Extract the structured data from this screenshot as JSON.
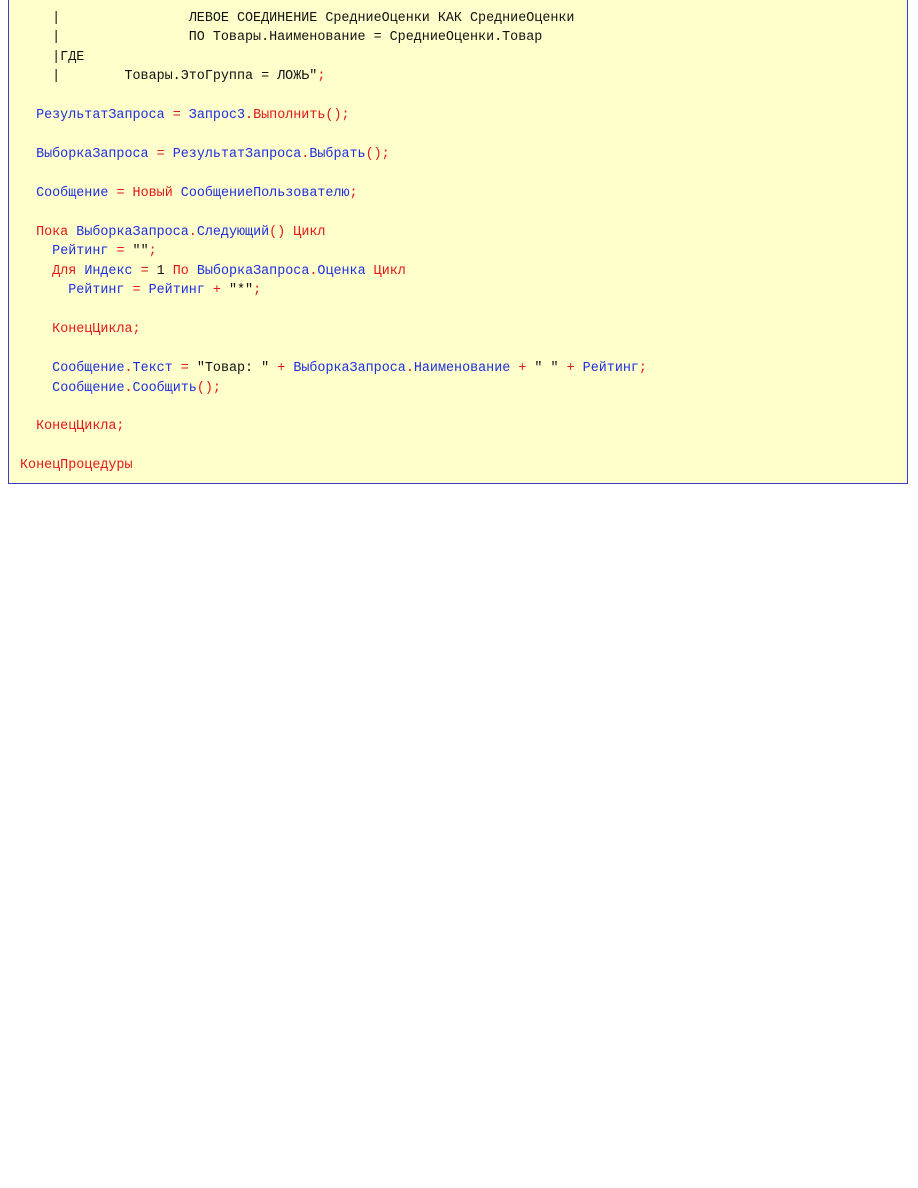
{
  "code": {
    "lines": [
      [
        {
          "c": "t",
          "s": "    |                ЛЕВОЕ СОЕДИНЕНИЕ СредниеОценки КАК СредниеОценки"
        }
      ],
      [
        {
          "c": "t",
          "s": "    |                ПО Товары.Наименование = СредниеОценки.Товар"
        }
      ],
      [
        {
          "c": "t",
          "s": "    |ГДЕ"
        }
      ],
      [
        {
          "c": "t",
          "s": "    |        Товары.ЭтоГруппа = ЛОЖЬ\""
        },
        {
          "c": "k",
          "s": ";"
        }
      ],
      [],
      [
        {
          "c": "t",
          "s": "  "
        },
        {
          "c": "i",
          "s": "РезультатЗапроса"
        },
        {
          "c": "t",
          "s": " "
        },
        {
          "c": "k",
          "s": "="
        },
        {
          "c": "t",
          "s": " "
        },
        {
          "c": "i",
          "s": "Запрос3"
        },
        {
          "c": "k",
          "s": "."
        },
        {
          "c": "k",
          "s": "Выполнить"
        },
        {
          "c": "k",
          "s": "();"
        }
      ],
      [],
      [
        {
          "c": "t",
          "s": "  "
        },
        {
          "c": "i",
          "s": "ВыборкаЗапроса"
        },
        {
          "c": "t",
          "s": " "
        },
        {
          "c": "k",
          "s": "="
        },
        {
          "c": "t",
          "s": " "
        },
        {
          "c": "i",
          "s": "РезультатЗапроса"
        },
        {
          "c": "k",
          "s": "."
        },
        {
          "c": "i",
          "s": "Выбрать"
        },
        {
          "c": "k",
          "s": "();"
        }
      ],
      [],
      [
        {
          "c": "t",
          "s": "  "
        },
        {
          "c": "i",
          "s": "Сообщение"
        },
        {
          "c": "t",
          "s": " "
        },
        {
          "c": "k",
          "s": "="
        },
        {
          "c": "t",
          "s": " "
        },
        {
          "c": "k",
          "s": "Новый"
        },
        {
          "c": "t",
          "s": " "
        },
        {
          "c": "i",
          "s": "СообщениеПользователю"
        },
        {
          "c": "k",
          "s": ";"
        }
      ],
      [],
      [
        {
          "c": "t",
          "s": "  "
        },
        {
          "c": "k",
          "s": "Пока"
        },
        {
          "c": "t",
          "s": " "
        },
        {
          "c": "i",
          "s": "ВыборкаЗапроса"
        },
        {
          "c": "k",
          "s": "."
        },
        {
          "c": "i",
          "s": "Следующий"
        },
        {
          "c": "k",
          "s": "()"
        },
        {
          "c": "t",
          "s": " "
        },
        {
          "c": "k",
          "s": "Цикл"
        }
      ],
      [
        {
          "c": "t",
          "s": "    "
        },
        {
          "c": "i",
          "s": "Рейтинг"
        },
        {
          "c": "t",
          "s": " "
        },
        {
          "c": "k",
          "s": "="
        },
        {
          "c": "t",
          "s": " \"\""
        },
        {
          "c": "k",
          "s": ";"
        }
      ],
      [
        {
          "c": "t",
          "s": "    "
        },
        {
          "c": "k",
          "s": "Для"
        },
        {
          "c": "t",
          "s": " "
        },
        {
          "c": "i",
          "s": "Индекс"
        },
        {
          "c": "t",
          "s": " "
        },
        {
          "c": "k",
          "s": "="
        },
        {
          "c": "t",
          "s": " 1 "
        },
        {
          "c": "k",
          "s": "По"
        },
        {
          "c": "t",
          "s": " "
        },
        {
          "c": "i",
          "s": "ВыборкаЗапроса"
        },
        {
          "c": "k",
          "s": "."
        },
        {
          "c": "i",
          "s": "Оценка"
        },
        {
          "c": "t",
          "s": " "
        },
        {
          "c": "k",
          "s": "Цикл"
        }
      ],
      [
        {
          "c": "t",
          "s": "      "
        },
        {
          "c": "i",
          "s": "Рейтинг"
        },
        {
          "c": "t",
          "s": " "
        },
        {
          "c": "k",
          "s": "="
        },
        {
          "c": "t",
          "s": " "
        },
        {
          "c": "i",
          "s": "Рейтинг"
        },
        {
          "c": "t",
          "s": " "
        },
        {
          "c": "k",
          "s": "+"
        },
        {
          "c": "t",
          "s": " \"*\""
        },
        {
          "c": "k",
          "s": ";"
        }
      ],
      [],
      [
        {
          "c": "t",
          "s": "    "
        },
        {
          "c": "k",
          "s": "КонецЦикла;"
        }
      ],
      [],
      [
        {
          "c": "t",
          "s": "    "
        },
        {
          "c": "i",
          "s": "Сообщение"
        },
        {
          "c": "k",
          "s": "."
        },
        {
          "c": "i",
          "s": "Текст"
        },
        {
          "c": "t",
          "s": " "
        },
        {
          "c": "k",
          "s": "="
        },
        {
          "c": "t",
          "s": " \"Товар: \" "
        },
        {
          "c": "k",
          "s": "+"
        },
        {
          "c": "t",
          "s": " "
        },
        {
          "c": "i",
          "s": "ВыборкаЗапроса"
        },
        {
          "c": "k",
          "s": "."
        },
        {
          "c": "i",
          "s": "Наименование"
        },
        {
          "c": "t",
          "s": " "
        },
        {
          "c": "k",
          "s": "+"
        },
        {
          "c": "t",
          "s": " \" \" "
        },
        {
          "c": "k",
          "s": "+"
        },
        {
          "c": "t",
          "s": " "
        },
        {
          "c": "i",
          "s": "Рейтинг"
        },
        {
          "c": "k",
          "s": ";"
        }
      ],
      [
        {
          "c": "t",
          "s": "    "
        },
        {
          "c": "i",
          "s": "Сообщение"
        },
        {
          "c": "k",
          "s": "."
        },
        {
          "c": "i",
          "s": "Сообщить"
        },
        {
          "c": "k",
          "s": "();"
        }
      ],
      [],
      [
        {
          "c": "t",
          "s": "  "
        },
        {
          "c": "k",
          "s": "КонецЦикла;"
        }
      ],
      [],
      [
        {
          "c": "k",
          "s": "КонецПроцедуры"
        }
      ]
    ]
  }
}
